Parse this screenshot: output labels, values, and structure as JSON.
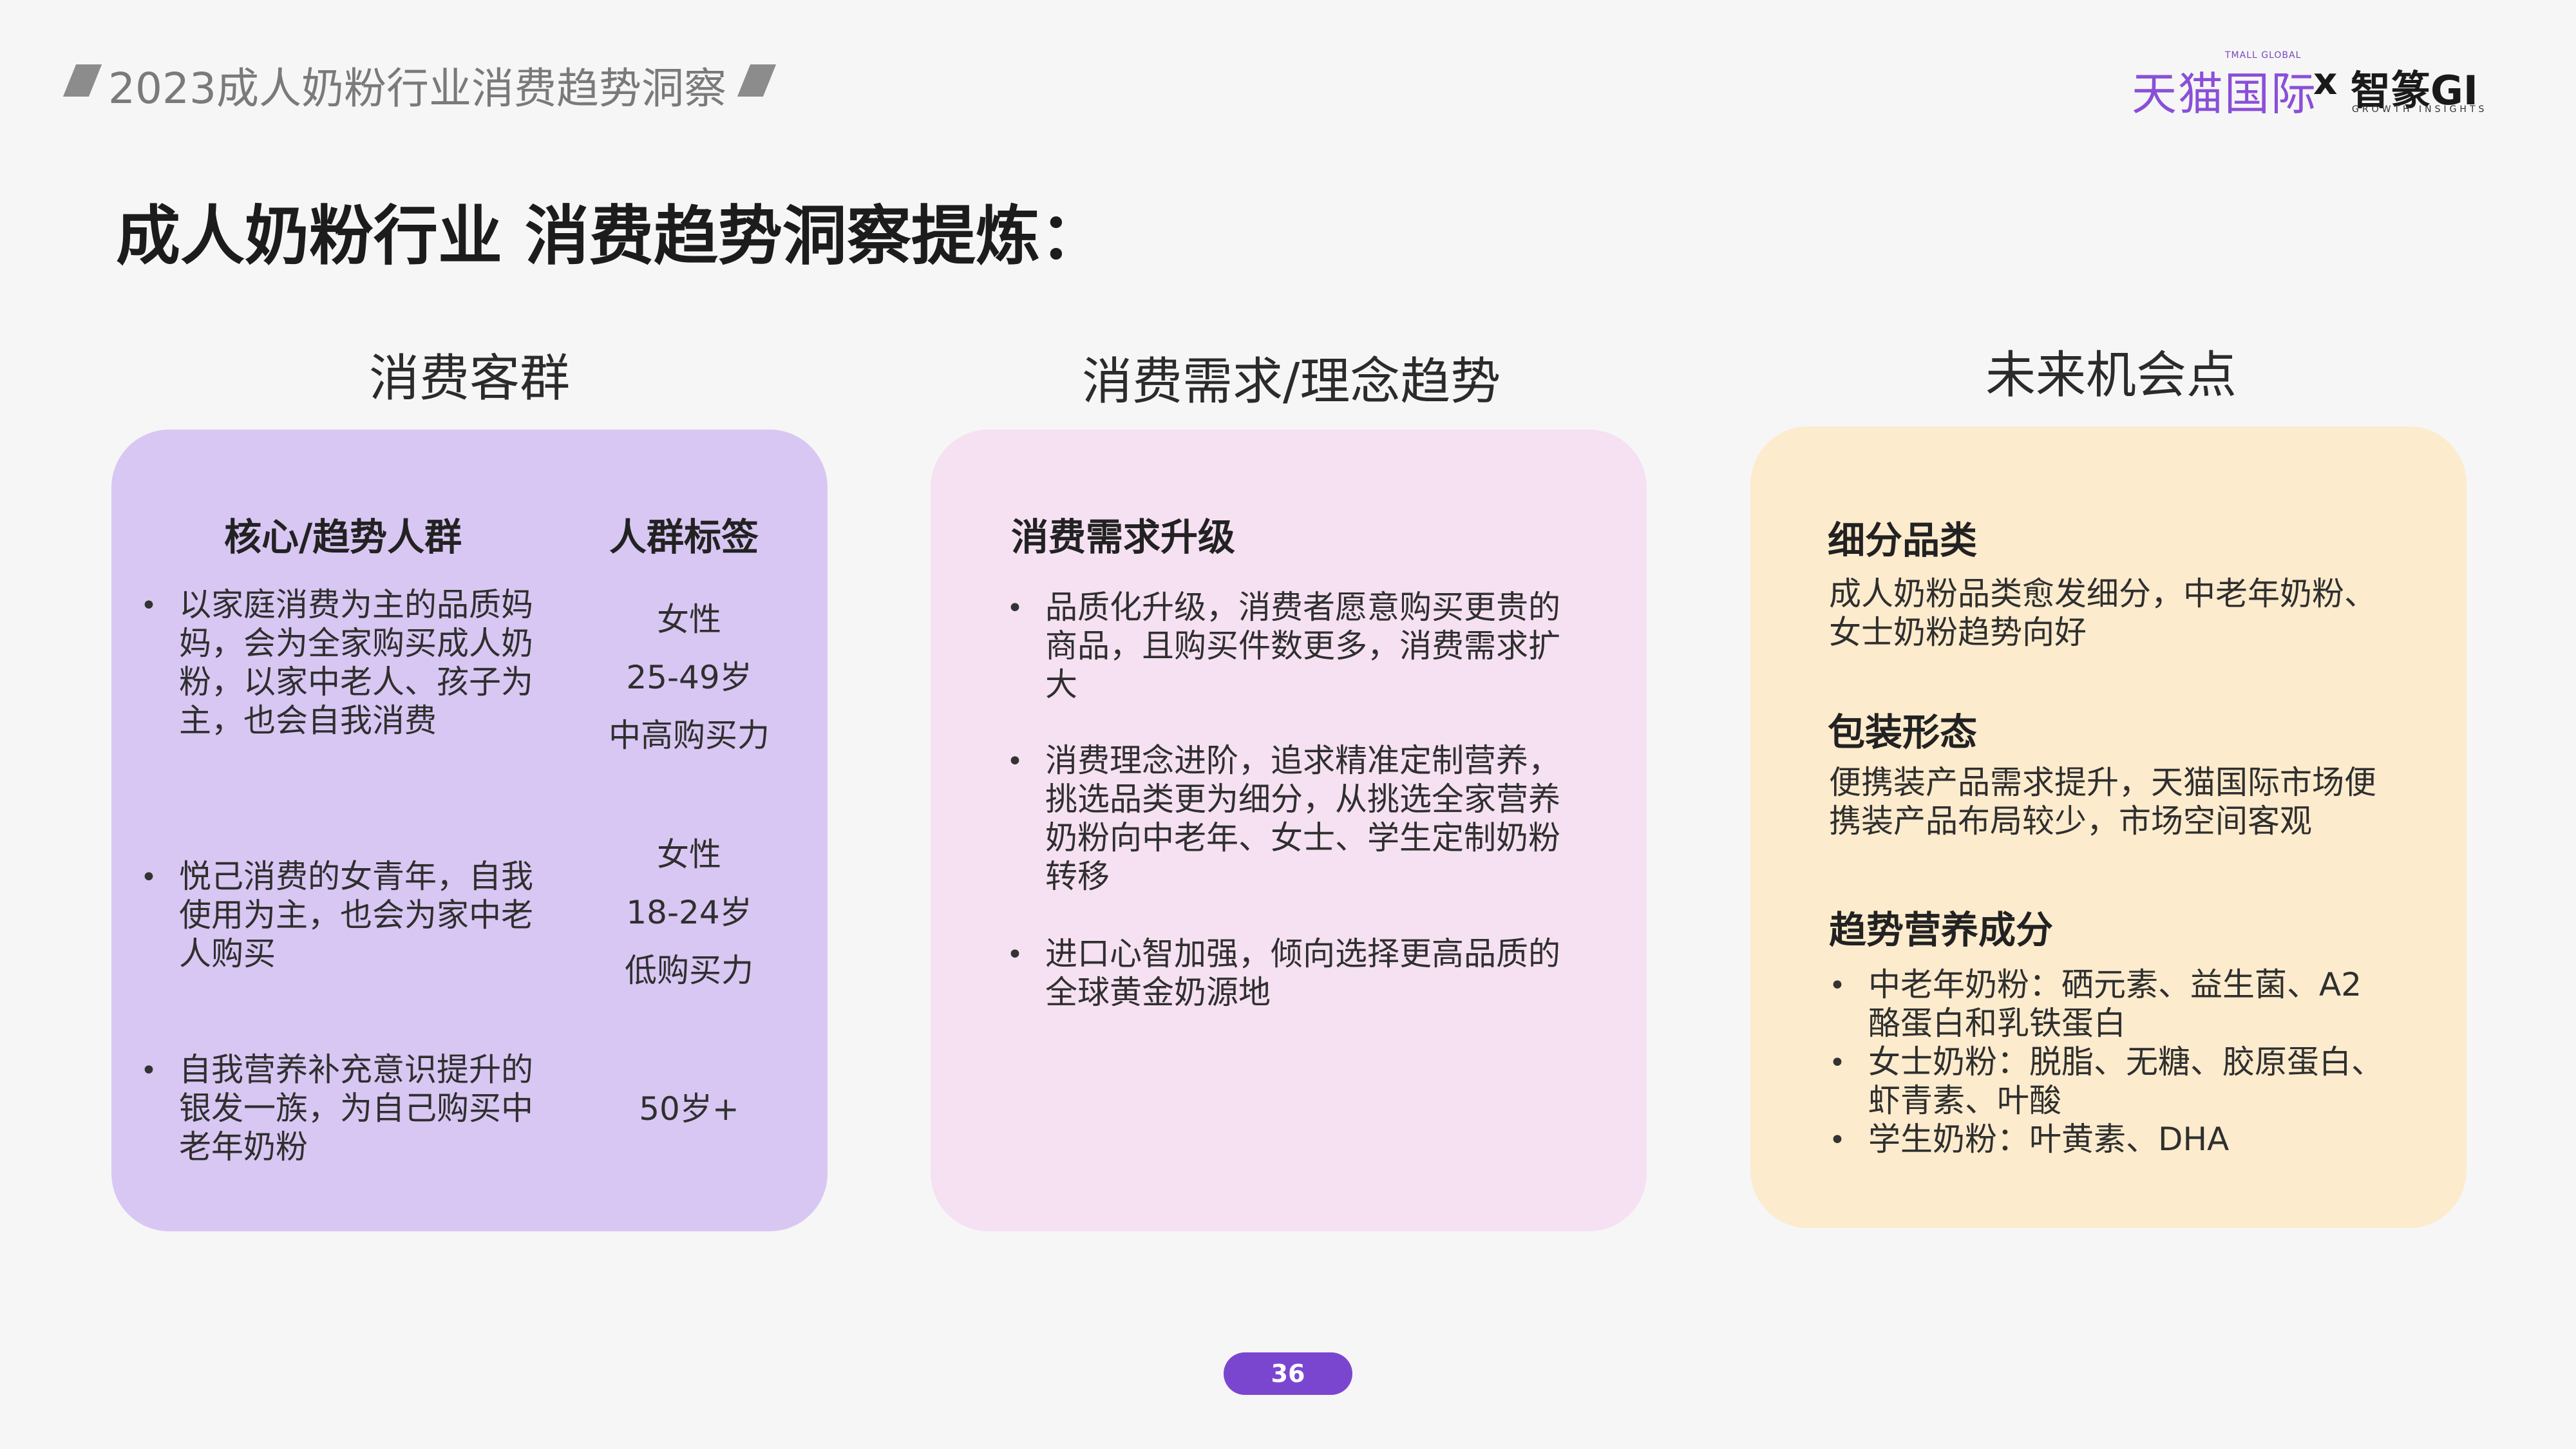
{
  "header": {
    "report_title": "2023成人奶粉行业消费趋势洞察",
    "logo_tmall_small": "TMALL GLOBAL",
    "logo_tmall": "天猫国际",
    "logo_x": "x",
    "logo_gi": "智篆GI",
    "logo_gi_sub": "GROWTH  INSIGHTS"
  },
  "main_title": "成人奶粉行业 消费趋势洞察提炼：",
  "columns": {
    "c1": {
      "title": "消费客群",
      "header_left": "核心/趋势人群",
      "header_right": "人群标签",
      "groups": [
        {
          "bullet": "•",
          "lines": [
            "以家庭消费为主的品质妈",
            "妈，会为全家购买成人奶",
            "粉，以家中老人、孩子为",
            "主，也会自我消费"
          ],
          "tags": [
            "女性",
            "25-49岁",
            "中高购买力"
          ]
        },
        {
          "bullet": "•",
          "lines": [
            "悦己消费的女青年，自我",
            "使用为主，也会为家中老",
            "人购买"
          ],
          "tags": [
            "女性",
            "18-24岁",
            "低购买力"
          ]
        },
        {
          "bullet": "•",
          "lines": [
            "自我营养补充意识提升的",
            "银发一族，为自己购买中",
            "老年奶粉"
          ],
          "tags": [
            "50岁+"
          ]
        }
      ]
    },
    "c2": {
      "title": "消费需求/理念趋势",
      "header": "消费需求升级",
      "items": [
        {
          "bullet": "•",
          "lines": [
            "品质化升级，消费者愿意购买更贵的",
            "商品，且购买件数更多，消费需求扩",
            "大"
          ]
        },
        {
          "bullet": "•",
          "lines": [
            "消费理念进阶，追求精准定制营养，",
            "挑选品类更为细分，从挑选全家营养",
            "奶粉向中老年、女士、学生定制奶粉",
            "转移"
          ]
        },
        {
          "bullet": "•",
          "lines": [
            "进口心智加强，倾向选择更高品质的",
            "全球黄金奶源地"
          ]
        }
      ]
    },
    "c3": {
      "title": "未来机会点",
      "sections": [
        {
          "header": "细分品类",
          "lines": [
            "成人奶粉品类愈发细分，中老年奶粉、",
            "女士奶粉趋势向好"
          ]
        },
        {
          "header": "包装形态",
          "lines": [
            "便携装产品需求提升，天猫国际市场便",
            "携装产品布局较少，市场空间客观"
          ]
        },
        {
          "header": "趋势营养成分",
          "bullets": [
            {
              "bullet": "•",
              "lines": [
                "中老年奶粉：硒元素、益生菌、A2",
                "酪蛋白和乳铁蛋白"
              ]
            },
            {
              "bullet": "•",
              "lines": [
                "女士奶粉：脱脂、无糖、胶原蛋白、",
                "虾青素、叶酸"
              ]
            },
            {
              "bullet": "•",
              "lines": [
                "学生奶粉：叶黄素、DHA"
              ]
            }
          ]
        }
      ]
    }
  },
  "page_number": "36",
  "colors": {
    "accent": "#7b46cf",
    "card1": "#d8c7f2",
    "card2": "#f5e1f2",
    "card3": "#fcebcd"
  }
}
